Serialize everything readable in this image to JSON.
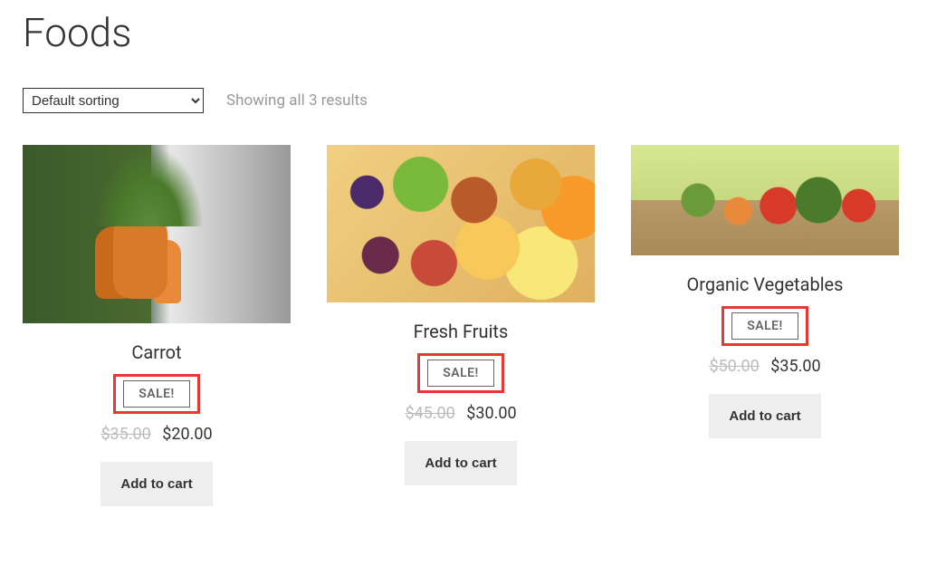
{
  "page": {
    "title": "Foods",
    "result_count": "Showing all 3 results",
    "sort_label": "Default sorting"
  },
  "products": [
    {
      "title": "Carrot",
      "sale_label": "SALE!",
      "price_old": "$35.00",
      "price_new": "$20.00",
      "cta": "Add to cart"
    },
    {
      "title": "Fresh Fruits",
      "sale_label": "SALE!",
      "price_old": "$45.00",
      "price_new": "$30.00",
      "cta": "Add to cart"
    },
    {
      "title": "Organic Vegetables",
      "sale_label": "SALE!",
      "price_old": "$50.00",
      "price_new": "$35.00",
      "cta": "Add to cart"
    }
  ]
}
